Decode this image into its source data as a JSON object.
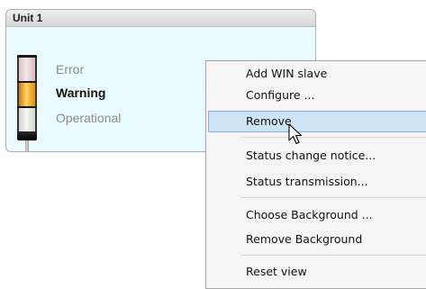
{
  "unit": {
    "title": "Unit 1",
    "statuses": [
      "Error",
      "Warning",
      "Operational"
    ],
    "active_status": "Warning"
  },
  "menu": {
    "items": [
      "Add WIN slave",
      "Configure ...",
      "Remove",
      "Status change notice...",
      "Status transmission...",
      "Choose Background ...",
      "Remove Background",
      "Reset view"
    ],
    "highlighted": "Remove"
  },
  "colors": {
    "panel_bg": "#eafcff",
    "warning_lamp": "#f3a417",
    "highlight_bg": "#cde4f7",
    "highlight_border": "#7eb4ea"
  },
  "icons": {
    "cursor": "arrow-pointer-icon"
  }
}
